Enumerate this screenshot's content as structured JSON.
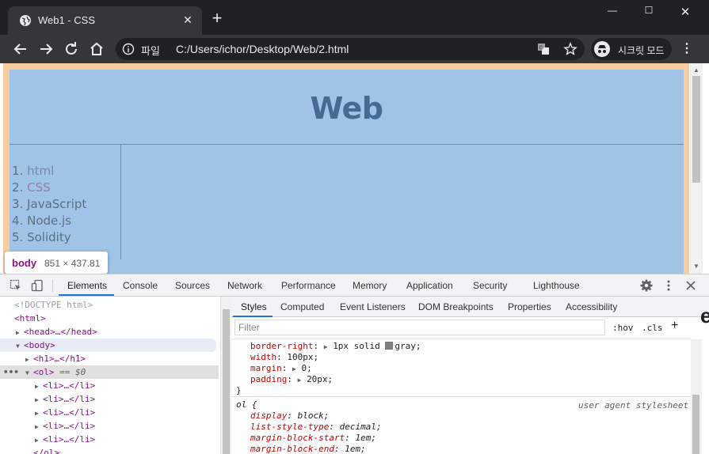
{
  "browser": {
    "tab_title": "Web1 - CSS",
    "tab_close": "✕",
    "new_tab": "+",
    "window_controls": {
      "minimize": "—",
      "maximize": "☐",
      "close": "✕"
    },
    "site_info_label": "파일",
    "url": "C:/Users/ichor/Desktop/Web/2.html",
    "incognito_label": "시크릿 모드",
    "menu": "⋮"
  },
  "page": {
    "heading": "Web",
    "list": [
      {
        "num": "1.",
        "text": "html"
      },
      {
        "num": "2.",
        "text": "CSS"
      },
      {
        "num": "3.",
        "text": "JavaScript"
      },
      {
        "num": "4.",
        "text": "Node.js"
      },
      {
        "num": "5.",
        "text": "Solidity"
      }
    ]
  },
  "inspect_tooltip": {
    "tag": "body",
    "size": "851 × 437.81"
  },
  "devtools": {
    "tabs": [
      "Elements",
      "Console",
      "Sources",
      "Network",
      "Performance",
      "Memory",
      "Application",
      "Security",
      "Lighthouse"
    ],
    "active_tab": "Elements",
    "dom": {
      "doctype": "<!DOCTYPE html>",
      "html_open": "<html>",
      "head": "<head>…</head>",
      "body_open": "<body>",
      "h1": "<h1>…</h1>",
      "ol_open": "<ol>",
      "ol_marker": "== $0",
      "li": "<li>…</li>",
      "ol_close": "</ol>",
      "ellipsis": "•••"
    },
    "styles_tabs": [
      "Styles",
      "Computed",
      "Event Listeners",
      "DOM Breakpoints",
      "Properties",
      "Accessibility"
    ],
    "filter_placeholder": "Filter",
    "hov": ":hov",
    "cls": ".cls",
    "add_rule": "+",
    "rule1": [
      {
        "prop": "border-right",
        "value": "1px solid gray;",
        "triangle": true,
        "swatch": true
      },
      {
        "prop": "width",
        "value": "100px;"
      },
      {
        "prop": "margin",
        "value": "0;",
        "triangle": true
      },
      {
        "prop": "padding",
        "value": "20px;",
        "triangle": true
      }
    ],
    "rule1_close": "}",
    "rule2_selector": "ol {",
    "rule2_source": "user agent stylesheet",
    "rule2": [
      {
        "prop": "display",
        "value": "block;"
      },
      {
        "prop": "list-style-type",
        "value": "decimal;"
      },
      {
        "prop": "margin-block-start",
        "value": "1em;"
      },
      {
        "prop": "margin-block-end",
        "value": "1em;"
      }
    ]
  },
  "edge_glyph": "e",
  "colors": {
    "margin": "#f9cc9d",
    "body_bg": "#a0c4e8",
    "heading": "#436c94",
    "chrome_dark": "#202124",
    "accent": "#1a73e8"
  }
}
